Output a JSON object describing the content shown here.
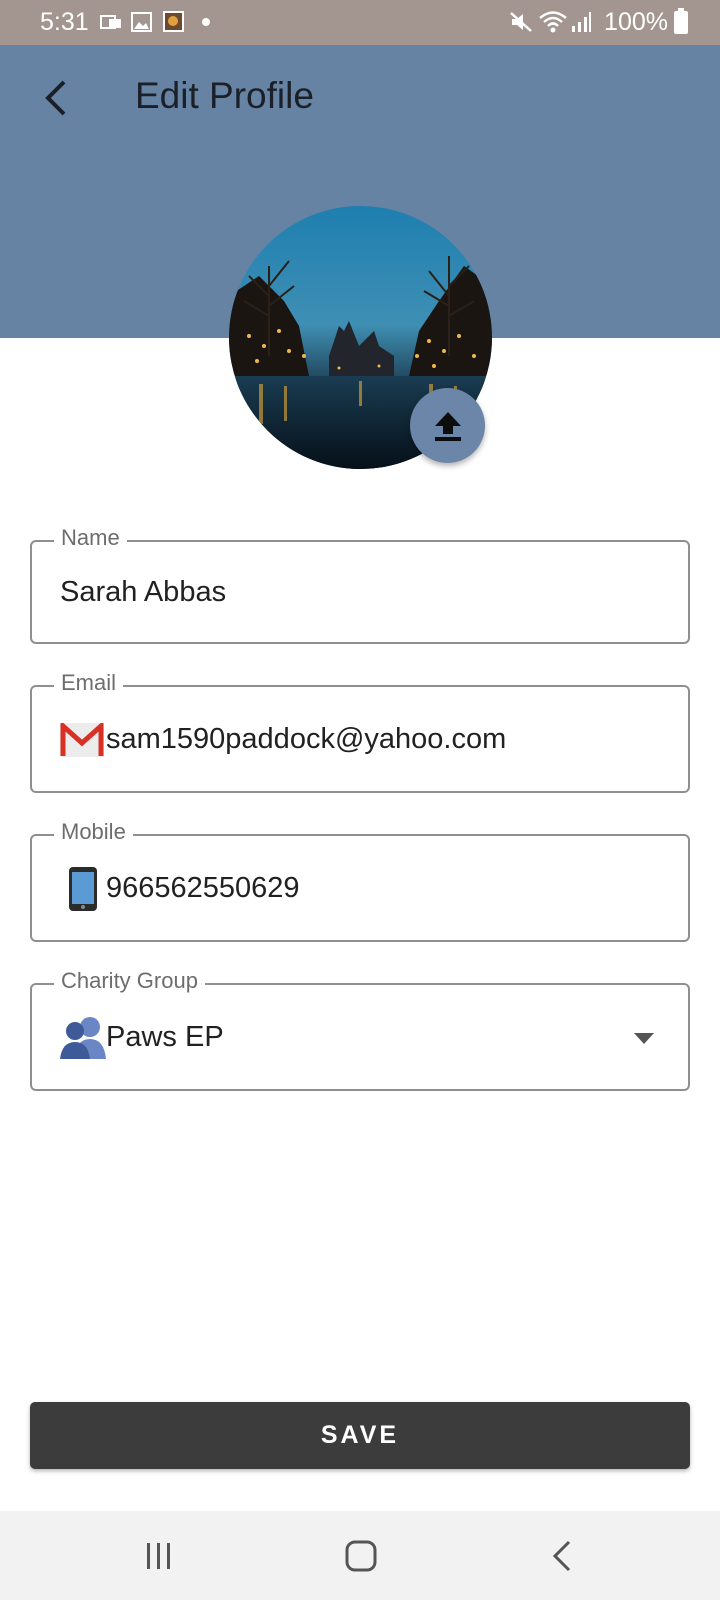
{
  "status_bar": {
    "time": "5:31",
    "battery": "100%"
  },
  "header": {
    "title": "Edit Profile",
    "back_icon": "back-arrow-icon",
    "color": "#6783a4"
  },
  "avatar": {
    "upload_icon": "upload-icon"
  },
  "form": {
    "name": {
      "label": "Name",
      "value": "Sarah Abbas"
    },
    "email": {
      "label": "Email",
      "value": "sam1590paddock@yahoo.com",
      "icon": "gmail-icon"
    },
    "mobile": {
      "label": "Mobile",
      "value": "966562550629",
      "icon": "phone-icon"
    },
    "charity_group": {
      "label": "Charity Group",
      "value": "Paws EP",
      "icon": "group-icon"
    }
  },
  "save_button": {
    "label": "SAVE",
    "color": "#3c3c3c"
  },
  "nav_bar": {
    "recents_icon": "recents-icon",
    "home_icon": "home-icon",
    "back_icon": "back-icon"
  }
}
